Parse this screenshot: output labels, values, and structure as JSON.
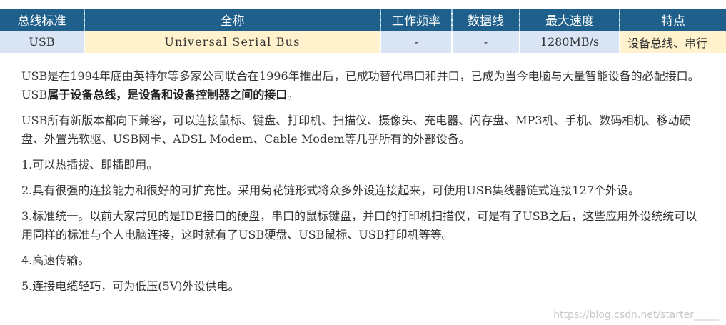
{
  "table": {
    "headers": [
      "总线标准",
      "全称",
      "工作频率",
      "数据线",
      "最大速度",
      "特点"
    ],
    "row": {
      "standard": "USB",
      "full_name": "Universal Serial Bus",
      "frequency": "-",
      "data_lines": "-",
      "max_speed": "1280MB/s",
      "feature": "设备总线、串行"
    }
  },
  "paragraphs": {
    "p1_text": "USB是在1994年底由英特尔等多家公司联合在1996年推出后，已成功替代串口和并口，已成为当今电脑与大量智能设备的必配接口。USB",
    "p1_bold": "属于设备总线，是设备和设备控制器之间的接口",
    "p1_end": "。",
    "p2": "USB所有新版本都向下兼容，可以连接鼠标、键盘、打印机、扫描仪、摄像头、充电器、闪存盘、MP3机、手机、数码相机、移动硬盘、外置光软驱、USB网卡、ADSL Modem、Cable Modem等几乎所有的外部设备。",
    "p3": "1.可以热插拔、即插即用。",
    "p4": "2.具有很强的连接能力和很好的可扩充性。采用菊花链形式将众多外设连接起来，可使用USB集线器链式连接127个外设。",
    "p5": "3.标准统一。以前大家常见的是IDE接口的硬盘，串口的鼠标键盘，并口的打印机扫描仪，可是有了USB之后，这些应用外设统统可以用同样的标准与个人电脑连接，这时就有了USB硬盘、USB鼠标、USB打印机等等。",
    "p6": "4.高速传输。",
    "p7": "5.连接电缆轻巧，可为低压(5V)外设供电。"
  },
  "watermark": "https://blog.csdn.net/starter_____",
  "colors": {
    "header_bg": "#1f5f8b",
    "cell_blue": "#d9e5f5",
    "cell_yellow": "#fff2cc"
  }
}
